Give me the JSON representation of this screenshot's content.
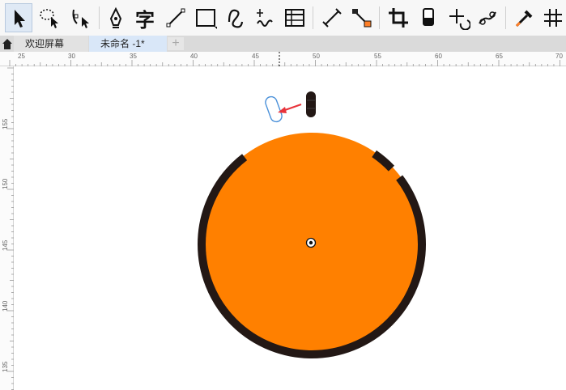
{
  "toolbar": {
    "tools": [
      {
        "name": "pick-tool",
        "icon": "arrow-cursor-icon"
      },
      {
        "name": "freehand-pick-tool",
        "icon": "lasso-cursor-icon"
      },
      {
        "name": "shape-tool",
        "icon": "node-shape-icon"
      },
      {
        "name": "pen-tool",
        "icon": "pen-nib-icon"
      },
      {
        "name": "text-tool",
        "icon": "text-char-icon",
        "glyph": "字"
      },
      {
        "name": "line-tool",
        "icon": "diagonal-line-icon"
      },
      {
        "name": "rectangle-tool",
        "icon": "rectangle-icon"
      },
      {
        "name": "spiral-tool",
        "icon": "curve-icon"
      },
      {
        "name": "artistic-media-tool",
        "icon": "artistic-wave-icon"
      },
      {
        "name": "table-tool",
        "icon": "table-grid-icon"
      },
      {
        "name": "dimension-tool",
        "icon": "dimension-line-icon"
      },
      {
        "name": "connector-tool",
        "icon": "connector-icon"
      },
      {
        "name": "crop-tool",
        "icon": "crop-icon"
      },
      {
        "name": "eraser-tool",
        "icon": "eraser-icon"
      },
      {
        "name": "transform-tool",
        "icon": "move-rotate-icon"
      },
      {
        "name": "blend-tool",
        "icon": "blend-icon"
      },
      {
        "name": "eyedropper-tool",
        "icon": "eyedropper-icon"
      },
      {
        "name": "grid-tool",
        "icon": "hash-grid-icon"
      }
    ]
  },
  "tabs": {
    "welcome": "欢迎屏幕",
    "document": "未命名 -1*",
    "add": "+"
  },
  "rulers": {
    "horizontal_labels": [
      "25",
      "30",
      "35",
      "40",
      "45",
      "50",
      "55",
      "60",
      "65",
      "70"
    ],
    "vertical_labels": [
      "155",
      "150",
      "145",
      "140",
      "135"
    ],
    "unit_marker": "⌐"
  },
  "colors": {
    "accent": "#4a90d9",
    "ring": "#231815",
    "fill": "#ff8000",
    "arrow": "#e8333a",
    "tab_active": "#d9e7f8"
  }
}
